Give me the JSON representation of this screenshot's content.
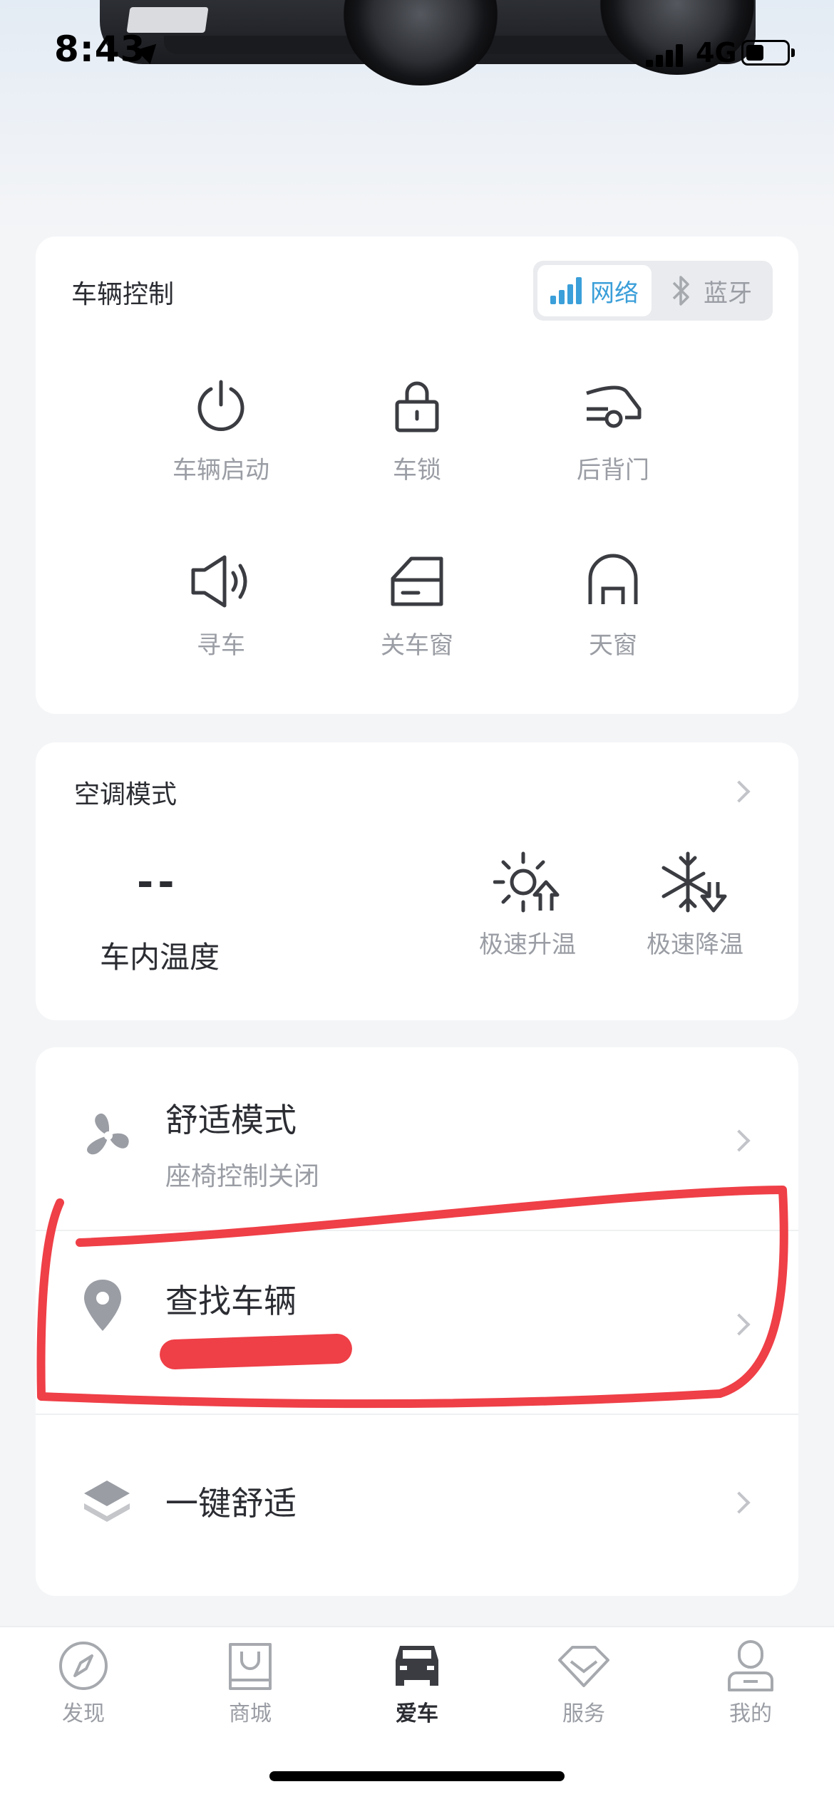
{
  "status_bar": {
    "time": "8:43",
    "network": "4G"
  },
  "vehicle_control": {
    "title": "车辆控制",
    "mode_toggle": {
      "network_label": "网络",
      "bluetooth_label": "蓝牙",
      "selected": "网络"
    },
    "controls": [
      {
        "label": "车辆启动",
        "icon": "power-icon"
      },
      {
        "label": "车锁",
        "icon": "lock-icon"
      },
      {
        "label": "后背门",
        "icon": "tailgate-icon"
      },
      {
        "label": "寻车",
        "icon": "speaker-icon"
      },
      {
        "label": "关车窗",
        "icon": "window-icon"
      },
      {
        "label": "天窗",
        "icon": "sunroof-icon"
      }
    ]
  },
  "climate": {
    "title": "空调模式",
    "temperature_value": "--",
    "temperature_label": "车内温度",
    "quick_heat_label": "极速升温",
    "quick_cool_label": "极速降温"
  },
  "features": [
    {
      "title": "舒适模式",
      "subtitle": "座椅控制关闭",
      "icon": "fan-icon"
    },
    {
      "title": "查找车辆",
      "subtitle": "",
      "icon": "location-pin-icon"
    },
    {
      "title": "一键舒适",
      "subtitle": "",
      "icon": "layers-icon"
    }
  ],
  "tab_bar": {
    "tabs": [
      {
        "label": "发现",
        "icon": "compass-icon"
      },
      {
        "label": "商城",
        "icon": "shopping-bag-icon"
      },
      {
        "label": "爱车",
        "icon": "car-icon"
      },
      {
        "label": "服务",
        "icon": "diamond-icon"
      },
      {
        "label": "我的",
        "icon": "profile-icon"
      }
    ],
    "active": "爱车"
  },
  "colors": {
    "accent": "#3b9fd9",
    "annotation_red": "#ef3f47",
    "text_primary": "#2b2d33",
    "text_secondary": "#9a9da4",
    "background": "#f4f5f7"
  }
}
